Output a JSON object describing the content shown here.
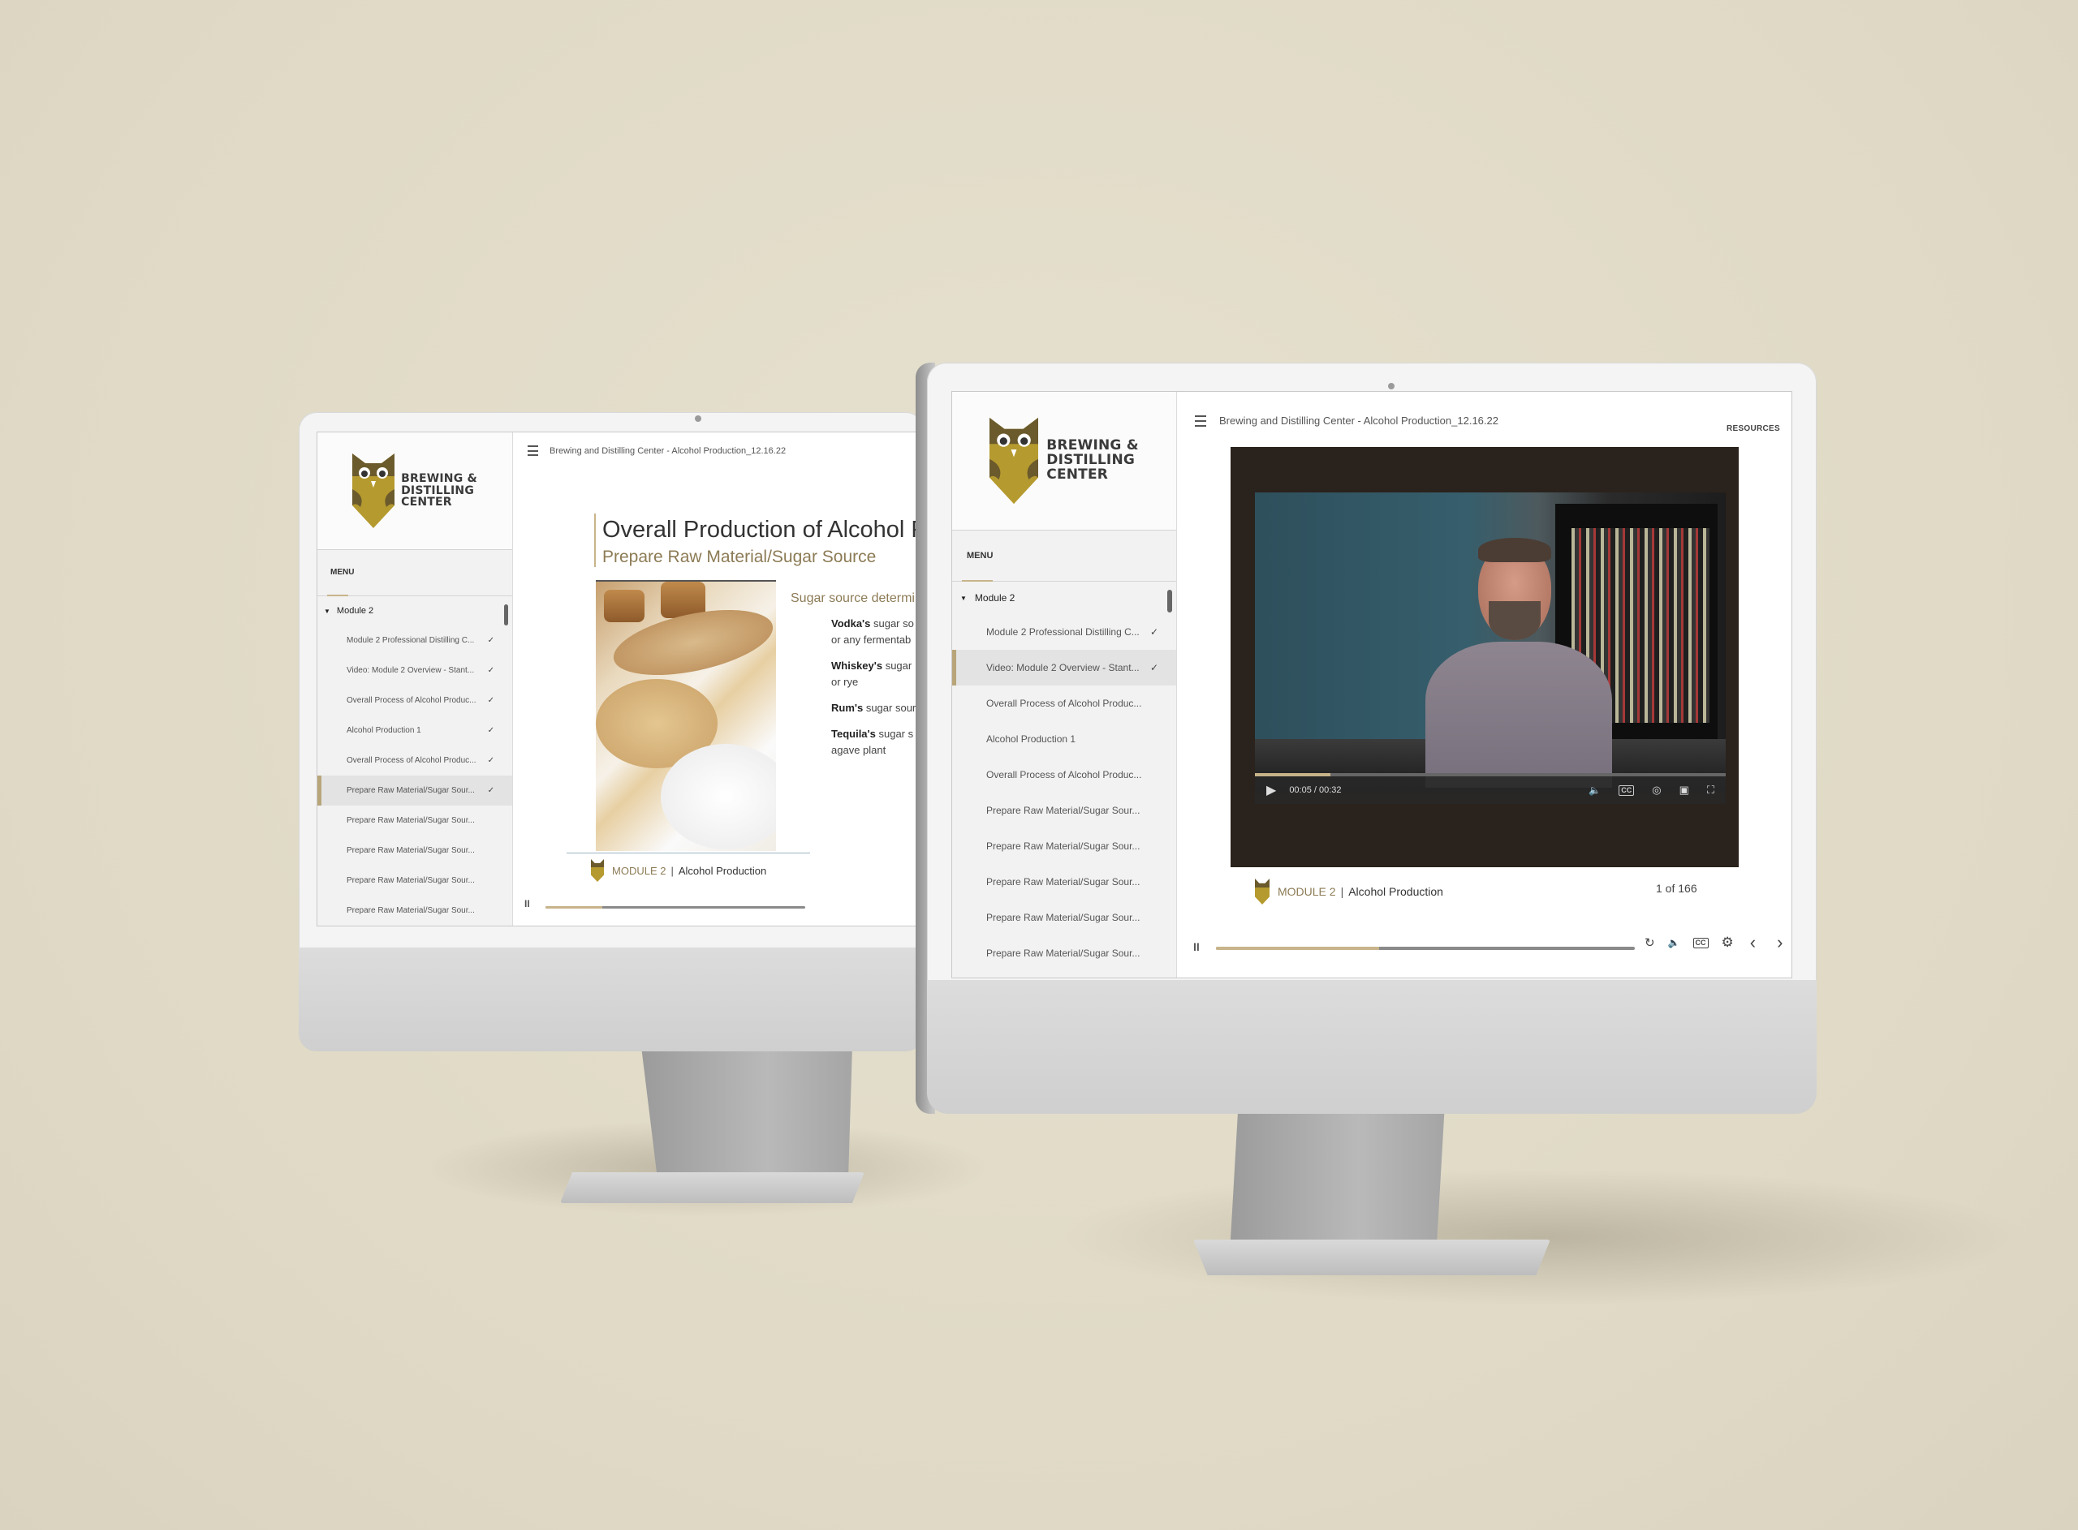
{
  "brand": {
    "logo_lines": [
      "BREWING &",
      "DISTILLING",
      "CENTER"
    ],
    "accent_color": "#b59a2f",
    "accent_soft": "#c8b48a"
  },
  "left_screen": {
    "header_title": "Brewing and Distilling Center - Alcohol Production_12.16.22",
    "menu_label": "MENU",
    "module": "Module 2",
    "items": [
      {
        "label": "Module 2 Professional Distilling C...",
        "done": "✓"
      },
      {
        "label": "Video: Module 2 Overview - Stant...",
        "done": "✓"
      },
      {
        "label": "Overall Process of Alcohol Produc...",
        "done": "✓"
      },
      {
        "label": "Alcohol Production 1",
        "done": "✓"
      },
      {
        "label": "Overall Process of Alcohol Produc...",
        "done": "✓"
      },
      {
        "label": "Prepare Raw Material/Sugar Sour...",
        "done": "✓",
        "active": true
      },
      {
        "label": "Prepare Raw Material/Sugar Sour...",
        "done": ""
      },
      {
        "label": "Prepare Raw Material/Sugar Sour...",
        "done": ""
      },
      {
        "label": "Prepare Raw Material/Sugar Sour...",
        "done": ""
      },
      {
        "label": "Prepare Raw Material/Sugar Sour...",
        "done": ""
      }
    ],
    "slide": {
      "title": "Overall Production of Alcohol Pr",
      "subtitle": "Prepare Raw Material/Sugar Source",
      "source_heading": "Sugar source determi",
      "bullets": [
        {
          "bold": "Vodka's",
          "rest": " sugar so",
          "line2": "or any fermentab"
        },
        {
          "bold": "Whiskey's",
          "rest": " sugar",
          "line2": "or rye"
        },
        {
          "bold": "Rum's",
          "rest": " sugar sour",
          "line2": ""
        },
        {
          "bold": "Tequila's",
          "rest": " sugar s",
          "line2": "agave plant"
        }
      ]
    },
    "footer": {
      "module_label": "MODULE 2",
      "separator": "|",
      "course": "Alcohol Production"
    },
    "progress": 0.22,
    "pause_label": "II"
  },
  "right_screen": {
    "header_title": "Brewing and Distilling Center - Alcohol Production_12.16.22",
    "resources_label": "RESOURCES",
    "menu_label": "MENU",
    "module": "Module 2",
    "items": [
      {
        "label": "Module 2 Professional Distilling C...",
        "done": "✓"
      },
      {
        "label": "Video: Module 2 Overview - Stant...",
        "done": "✓",
        "active": true
      },
      {
        "label": "Overall Process of Alcohol Produc...",
        "done": ""
      },
      {
        "label": "Alcohol Production 1",
        "done": ""
      },
      {
        "label": "Overall Process of Alcohol Produc...",
        "done": ""
      },
      {
        "label": "Prepare Raw Material/Sugar Sour...",
        "done": ""
      },
      {
        "label": "Prepare Raw Material/Sugar Sour...",
        "done": ""
      },
      {
        "label": "Prepare Raw Material/Sugar Sour...",
        "done": ""
      },
      {
        "label": "Prepare Raw Material/Sugar Sour...",
        "done": ""
      },
      {
        "label": "Prepare Raw Material/Sugar Sour...",
        "done": ""
      }
    ],
    "video": {
      "time": "00:05 / 00:32",
      "progress": 0.16,
      "controls": [
        "play-icon",
        "volume-icon",
        "captions-icon",
        "playback-speed-icon",
        "picture-in-picture-icon",
        "fullscreen-icon"
      ],
      "cc_label": "CC"
    },
    "footer": {
      "module_label": "MODULE 2",
      "separator": "|",
      "course": "Alcohol Production"
    },
    "counter": "1 of 166",
    "progress": 0.39,
    "pause_label": "II",
    "controls": {
      "replay_glyph": "↻",
      "volume_glyph": "🔈",
      "cc_label": "CC",
      "settings_glyph": "⚙",
      "prev_glyph": "‹",
      "next_glyph": "›"
    }
  }
}
